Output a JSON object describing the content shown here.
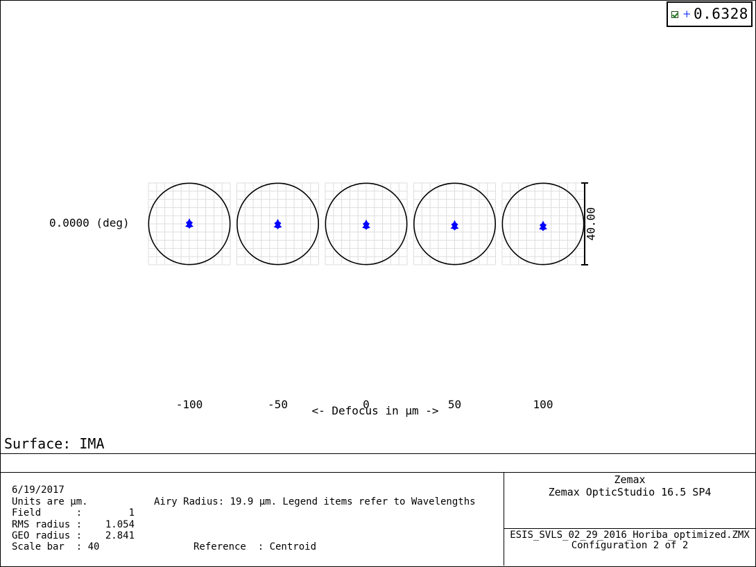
{
  "legend": {
    "wavelength": "0.6328",
    "checked": true,
    "marker": "+"
  },
  "field_label": "0.0000 (deg)",
  "surface_label": "Surface: IMA",
  "chart_data": {
    "type": "scatter",
    "subtype": "through-focus spot diagram",
    "x_label": "<- Defocus in µm ->",
    "defocus_values": [
      -100,
      -50,
      0,
      50,
      100
    ],
    "tick_labels": [
      "-100",
      "-50",
      "0",
      "50",
      "100"
    ],
    "field": "0.0000 (deg)",
    "scale_bar": "40.00",
    "box_size_um": 40,
    "airy_radius_um": 19.9,
    "spot_color": "#0000ff",
    "grid": true,
    "series": [
      {
        "defocus": -100,
        "centroid_y_um": 0.4
      },
      {
        "defocus": -50,
        "centroid_y_um": 0.1
      },
      {
        "defocus": 0,
        "centroid_y_um": -0.2
      },
      {
        "defocus": 50,
        "centroid_y_um": -0.5
      },
      {
        "defocus": 100,
        "centroid_y_um": -0.8
      }
    ]
  },
  "info": {
    "date": "6/19/2017",
    "units": "Units are µm.",
    "airy": "Airy Radius: 19.9 µm. Legend items refer to Wavelengths",
    "field_row": "Field      :        1",
    "rms_row": "RMS radius :    1.054",
    "geo_row": "GEO radius :    2.841",
    "scale_row": "Scale bar  : 40",
    "reference": "Reference  : Centroid"
  },
  "product": {
    "company": "Zemax",
    "name": "Zemax OpticStudio 16.5 SP4",
    "file": "ESIS_SVLS_02_29_2016_Horiba_optimized.ZMX",
    "config": "Configuration 2 of 2"
  }
}
